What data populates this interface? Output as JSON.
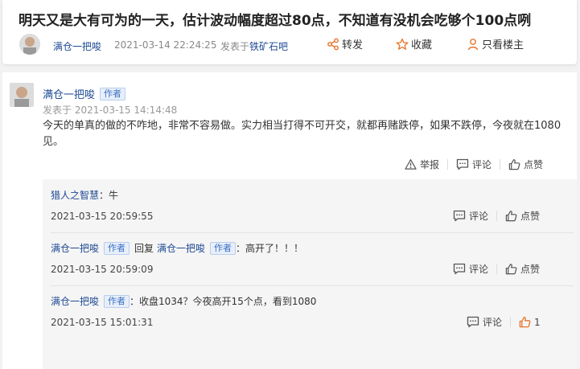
{
  "thread": {
    "title": "明天又是大有可为的一天，估计波动幅度超过80点，不知道有没机会吃够个100点咧",
    "author": "满仓一把唆",
    "time": "2021-03-14 22:24:25",
    "published_in_prefix": "发表于",
    "forum": "铁矿石吧",
    "actions": {
      "share": "转发",
      "favorite": "收藏",
      "only_author": "只看楼主"
    }
  },
  "post": {
    "author": "满仓一把唆",
    "author_tag": "作者",
    "time": "发表于 2021-03-15 14:14:48",
    "content": "今天的单真的做的不咋地，非常不容易做。实力相当打得不可开交，就都再赌跌停，如果不跌停，今夜就在1080见。",
    "ops": {
      "report": "举报",
      "comment": "评论",
      "like": "点赞"
    }
  },
  "replies": [
    {
      "user": "猎人之智慧",
      "text": "：牛",
      "time": "2021-03-15 20:59:55",
      "comment_label": "评论",
      "like_label": "点赞"
    },
    {
      "user": "满仓一把唆",
      "user_tag": "作者",
      "reply_word": "回复",
      "target": "满仓一把唆",
      "target_tag": "作者",
      "text": "：高开了！！！",
      "time": "2021-03-15 20:59:09",
      "comment_label": "评论",
      "like_label": "点赞"
    },
    {
      "user": "满仓一把唆",
      "user_tag": "作者",
      "text": "：收盘1034？今夜高开15个点，看到1080",
      "time": "2021-03-15 15:01:31",
      "comment_label": "评论",
      "like_count": "1"
    }
  ],
  "colors": {
    "link_blue": "#1f4a94",
    "like_active": "#e8732a",
    "action_icon": "#e8732a"
  },
  "icons": {
    "share": "share-icon",
    "favorite": "star-icon",
    "only_author": "person-icon",
    "report": "warning-icon",
    "comment": "comment-icon",
    "like": "thumbs-up-icon"
  }
}
